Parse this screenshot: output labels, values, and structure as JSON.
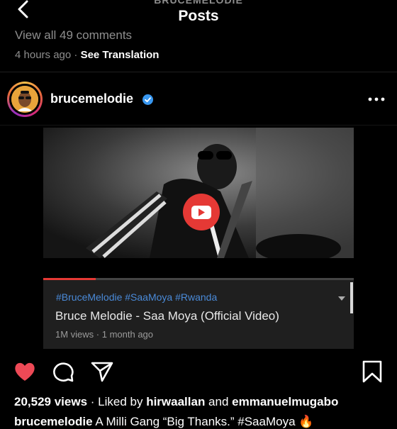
{
  "header": {
    "subtitle": "BRUCEMELODIE",
    "title": "Posts"
  },
  "previous_post": {
    "view_all": "View all 49 comments",
    "time": "4 hours ago",
    "separator": " · ",
    "see_translation": "See Translation"
  },
  "post": {
    "username": "brucemelodie",
    "verified": true,
    "media": {
      "hashtags": "#BruceMelodie #SaaMoya #Rwanda",
      "video_title": "Bruce Melodie - Saa Moya (Official Video)",
      "video_meta": "1M views · 1 month ago",
      "progress": 0.17
    },
    "actions": {
      "like_icon": "heart-icon",
      "liked": true,
      "comment_icon": "comment-icon",
      "share_icon": "send-icon",
      "save_icon": "bookmark-icon"
    },
    "stats": {
      "views": "20,529 views",
      "liked_by_prefix": " · Liked by ",
      "liked_by_1": "hirwaallan",
      "and": " and ",
      "liked_by_2": "emmanuelmugabo"
    },
    "caption": {
      "username": "brucemelodie",
      "text": " A Milli Gang “Big Thanks.” #SaaMoya 🔥"
    }
  },
  "colors": {
    "background": "#000000",
    "like_red": "#ed4956",
    "verified_blue": "#3897f0",
    "youtube_red": "#e53935",
    "hashtag_blue": "#4a8ad8"
  }
}
